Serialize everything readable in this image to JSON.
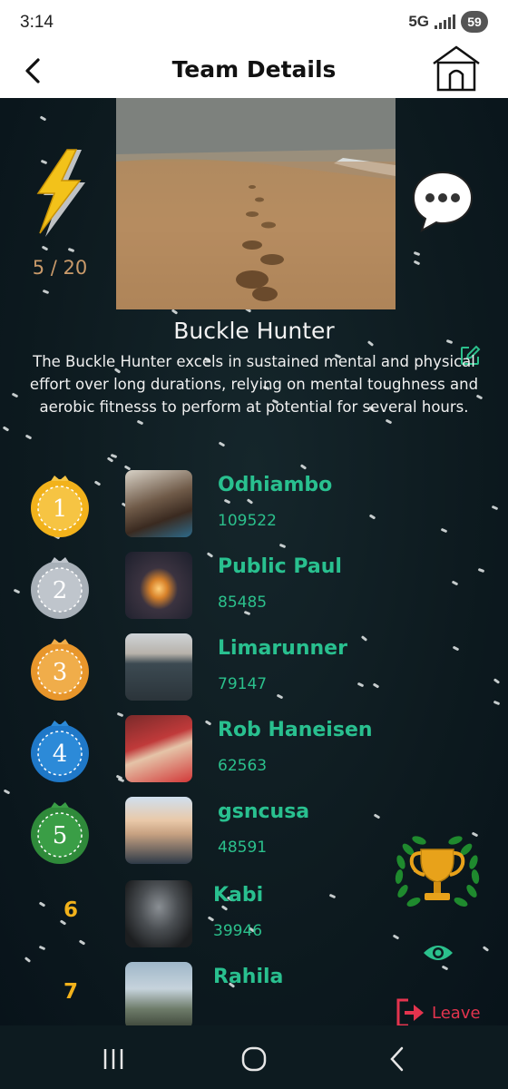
{
  "status": {
    "time": "3:14",
    "network": "5G",
    "battery": "59"
  },
  "header": {
    "title": "Team Details"
  },
  "team": {
    "count": "5 / 20",
    "name": "Buckle Hunter",
    "description": "The Buckle Hunter excels in sustained mental and physical effort over long durations, relying on mental toughness and aerobic fitnesss to perform at potential for several hours."
  },
  "members": [
    {
      "rank": "1",
      "name": "Odhiambo",
      "score": "109522",
      "medal_color": "#f2b21b"
    },
    {
      "rank": "2",
      "name": "Public Paul",
      "score": "85485",
      "medal_color": "#a8b0b8"
    },
    {
      "rank": "3",
      "name": "Limarunner",
      "score": "79147",
      "medal_color": "#e8962b"
    },
    {
      "rank": "4",
      "name": "Rob Haneisen",
      "score": "62563",
      "medal_color": "#1f78c8"
    },
    {
      "rank": "5",
      "name": "gsncusa",
      "score": "48591",
      "medal_color": "#2f8a3a"
    },
    {
      "rank": "6",
      "name": "Kabi",
      "score": "39946"
    },
    {
      "rank": "7",
      "name": "Rahila",
      "score": ""
    }
  ],
  "actions": {
    "leave_label": "Leave"
  },
  "icons": {
    "back": "arrow-left-icon",
    "home": "home-icon",
    "energy": "lightning-bolt-icon",
    "chat": "chat-bubble-icon",
    "edit": "edit-icon",
    "trophy": "trophy-laurel-icon",
    "view": "eye-icon",
    "leave": "logout-icon"
  },
  "colors": {
    "accent": "#29c08f",
    "gold": "#f2b21b",
    "danger": "#e3344e",
    "count": "#c99a6a"
  }
}
